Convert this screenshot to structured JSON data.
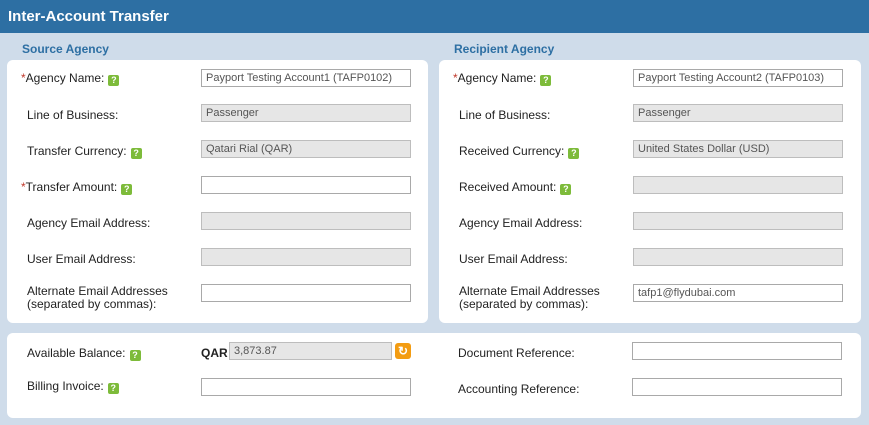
{
  "title": "Inter-Account Transfer",
  "help_glyph": "?",
  "required_mark": "*",
  "source": {
    "heading": "Source Agency",
    "agency_name_label": "Agency Name:",
    "agency_name_value": "Payport Testing Account1 (TAFP0102)",
    "line_of_business_label": "Line of Business:",
    "line_of_business_value": "Passenger",
    "currency_label": "Transfer Currency:",
    "currency_value": "Qatari Rial (QAR)",
    "amount_label": "Transfer Amount:",
    "amount_value": "",
    "agency_email_label": "Agency Email Address:",
    "agency_email_value": "",
    "user_email_label": "User Email Address:",
    "user_email_value": "",
    "alt_email_label_1": "Alternate Email Addresses",
    "alt_email_label_2": "(separated by commas):",
    "alt_email_value": ""
  },
  "recipient": {
    "heading": "Recipient Agency",
    "agency_name_label": "Agency Name:",
    "agency_name_value": "Payport Testing Account2 (TAFP0103)",
    "line_of_business_label": "Line of Business:",
    "line_of_business_value": "Passenger",
    "currency_label": "Received Currency:",
    "currency_value": "United States Dollar (USD)",
    "amount_label": "Received Amount:",
    "amount_value": "",
    "agency_email_label": "Agency Email Address:",
    "agency_email_value": "",
    "user_email_label": "User Email Address:",
    "user_email_value": "",
    "alt_email_label_1": "Alternate Email Addresses",
    "alt_email_label_2": "(separated by commas):",
    "alt_email_value": "tafp1@flydubai.com"
  },
  "bottom": {
    "available_balance_label": "Available Balance:",
    "currency_code": "QAR",
    "available_balance_value": "3,873.87",
    "refresh_icon": "refresh-icon",
    "billing_invoice_label": "Billing Invoice:",
    "billing_invoice_value": "",
    "document_reference_label": "Document Reference:",
    "document_reference_value": "",
    "accounting_reference_label": "Accounting Reference:",
    "accounting_reference_value": ""
  },
  "colors": {
    "header": "#2d6fa3",
    "page_bg": "#cfdcea",
    "help_icon": "#7dbb3a",
    "required": "#c0392b",
    "refresh": "#f39c12"
  }
}
